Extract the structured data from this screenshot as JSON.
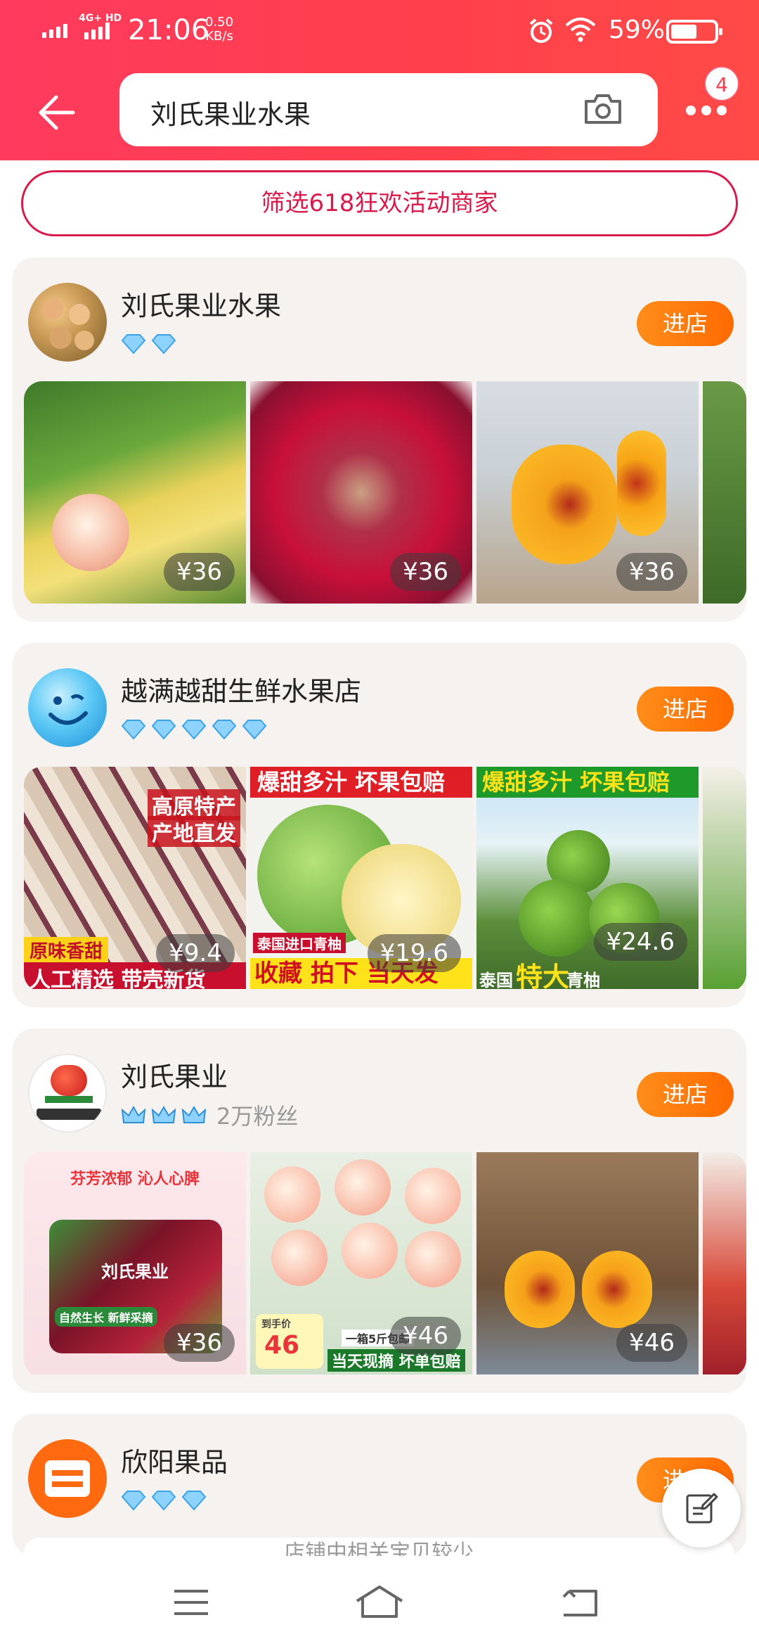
{
  "status_bar": {
    "network": "4G+ HD",
    "time": "21:06",
    "speed_value": "0.50",
    "speed_unit": "KB/s",
    "battery": "59%"
  },
  "search": {
    "query": "刘氏果业水果",
    "notification_count": "4"
  },
  "filter_label": "筛选618狂欢活动商家",
  "stores": [
    {
      "name": "刘氏果业水果",
      "enter_label": "进店",
      "products": [
        {
          "price": "¥36"
        },
        {
          "price": "¥36"
        },
        {
          "price": "¥36"
        }
      ]
    },
    {
      "name": "越满越甜生鲜水果店",
      "enter_label": "进店",
      "products": [
        {
          "price": "¥9.4",
          "tag1": "高原特产",
          "tag2": "产地直发",
          "tag3": "原味香甜",
          "tag4": "人工精选 带壳新货"
        },
        {
          "price": "¥19.6",
          "tag1": "爆甜多汁 坏果包赔",
          "tag2": "泰国进口青柚",
          "tag3": "收藏 拍下 当天发"
        },
        {
          "price": "¥24.6",
          "tag1": "爆甜多汁 坏果包赔",
          "tag2": "泰国",
          "tag3": "特大",
          "tag4": "青柚"
        }
      ]
    },
    {
      "name": "刘氏果业",
      "fans": "2万粉丝",
      "enter_label": "进店",
      "products": [
        {
          "price": "¥36",
          "tag1": "芬芳浓郁 沁人心脾",
          "tag2": "刘氏果业",
          "tag3": "自然生长 新鲜采摘"
        },
        {
          "price": "¥46",
          "tag1": "到手价",
          "tag2": "46",
          "tag3": "一箱5斤包邮",
          "tag4": "当天现摘 坏单包赔"
        },
        {
          "price": "¥46"
        }
      ]
    },
    {
      "name": "欣阳果品",
      "enter_label": "进店",
      "note": "店铺中相关宝贝较少"
    }
  ]
}
